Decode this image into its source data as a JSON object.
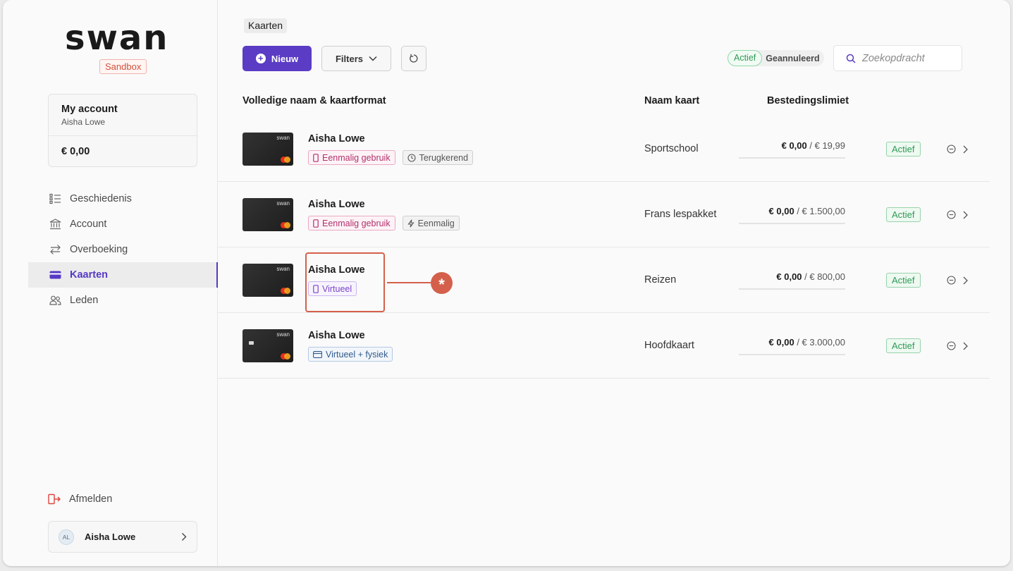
{
  "app": {
    "logo_text": "swan",
    "environment_badge": "Sandbox"
  },
  "account": {
    "title": "My account",
    "holder": "Aisha Lowe",
    "balance": "€ 0,00"
  },
  "nav": {
    "items": [
      {
        "label": "Geschiedenis",
        "icon": "list-icon"
      },
      {
        "label": "Account",
        "icon": "bank-icon"
      },
      {
        "label": "Overboeking",
        "icon": "transfer-arrows-icon"
      },
      {
        "label": "Kaarten",
        "icon": "credit-card-icon",
        "active": true
      },
      {
        "label": "Leden",
        "icon": "people-icon"
      }
    ],
    "logout": "Afmelden"
  },
  "user": {
    "initials": "AL",
    "name": "Aisha Lowe"
  },
  "header": {
    "page_title": "Kaarten",
    "new_button": "Nieuw",
    "filters_button": "Filters",
    "toggle_active": "Actief",
    "toggle_cancelled": "Geannuleerd",
    "search_placeholder": "Zoekopdracht"
  },
  "table": {
    "columns": {
      "name": "Volledige naam & kaartformat",
      "card_name": "Naam kaart",
      "limit": "Bestedingslimiet"
    },
    "rows": [
      {
        "holder": "Aisha Lowe",
        "tags": [
          {
            "label": "Eenmalig gebruik",
            "icon": "phone-icon",
            "style": "pink"
          },
          {
            "label": "Terugkerend",
            "icon": "clock-icon",
            "style": "gray"
          }
        ],
        "card_name": "Sportschool",
        "spent": "€ 0,00",
        "limit": "/ € 19,99",
        "status": "Actief"
      },
      {
        "holder": "Aisha Lowe",
        "tags": [
          {
            "label": "Eenmalig gebruik",
            "icon": "phone-icon",
            "style": "pink"
          },
          {
            "label": "Eenmalig",
            "icon": "lightning-icon",
            "style": "gray"
          }
        ],
        "card_name": "Frans lespakket",
        "spent": "€ 0,00",
        "limit": "/ € 1.500,00",
        "status": "Actief"
      },
      {
        "holder": "Aisha Lowe",
        "tags": [
          {
            "label": "Virtueel",
            "icon": "phone-icon",
            "style": "purple"
          }
        ],
        "card_name": "Reizen",
        "spent": "€ 0,00",
        "limit": "/ € 800,00",
        "status": "Actief"
      },
      {
        "holder": "Aisha Lowe",
        "tags": [
          {
            "label": "Virtueel + fysiek",
            "icon": "card-icon",
            "style": "blue"
          }
        ],
        "card_name": "Hoofdkaart",
        "spent": "€ 0,00",
        "limit": "/ € 3.000,00",
        "status": "Actief"
      }
    ],
    "card_brand": "swan"
  },
  "annotation": {
    "marker": "*",
    "color": "#d4604b"
  },
  "colors": {
    "accent": "#5b3cc4",
    "status_green": "#2f9a55"
  }
}
